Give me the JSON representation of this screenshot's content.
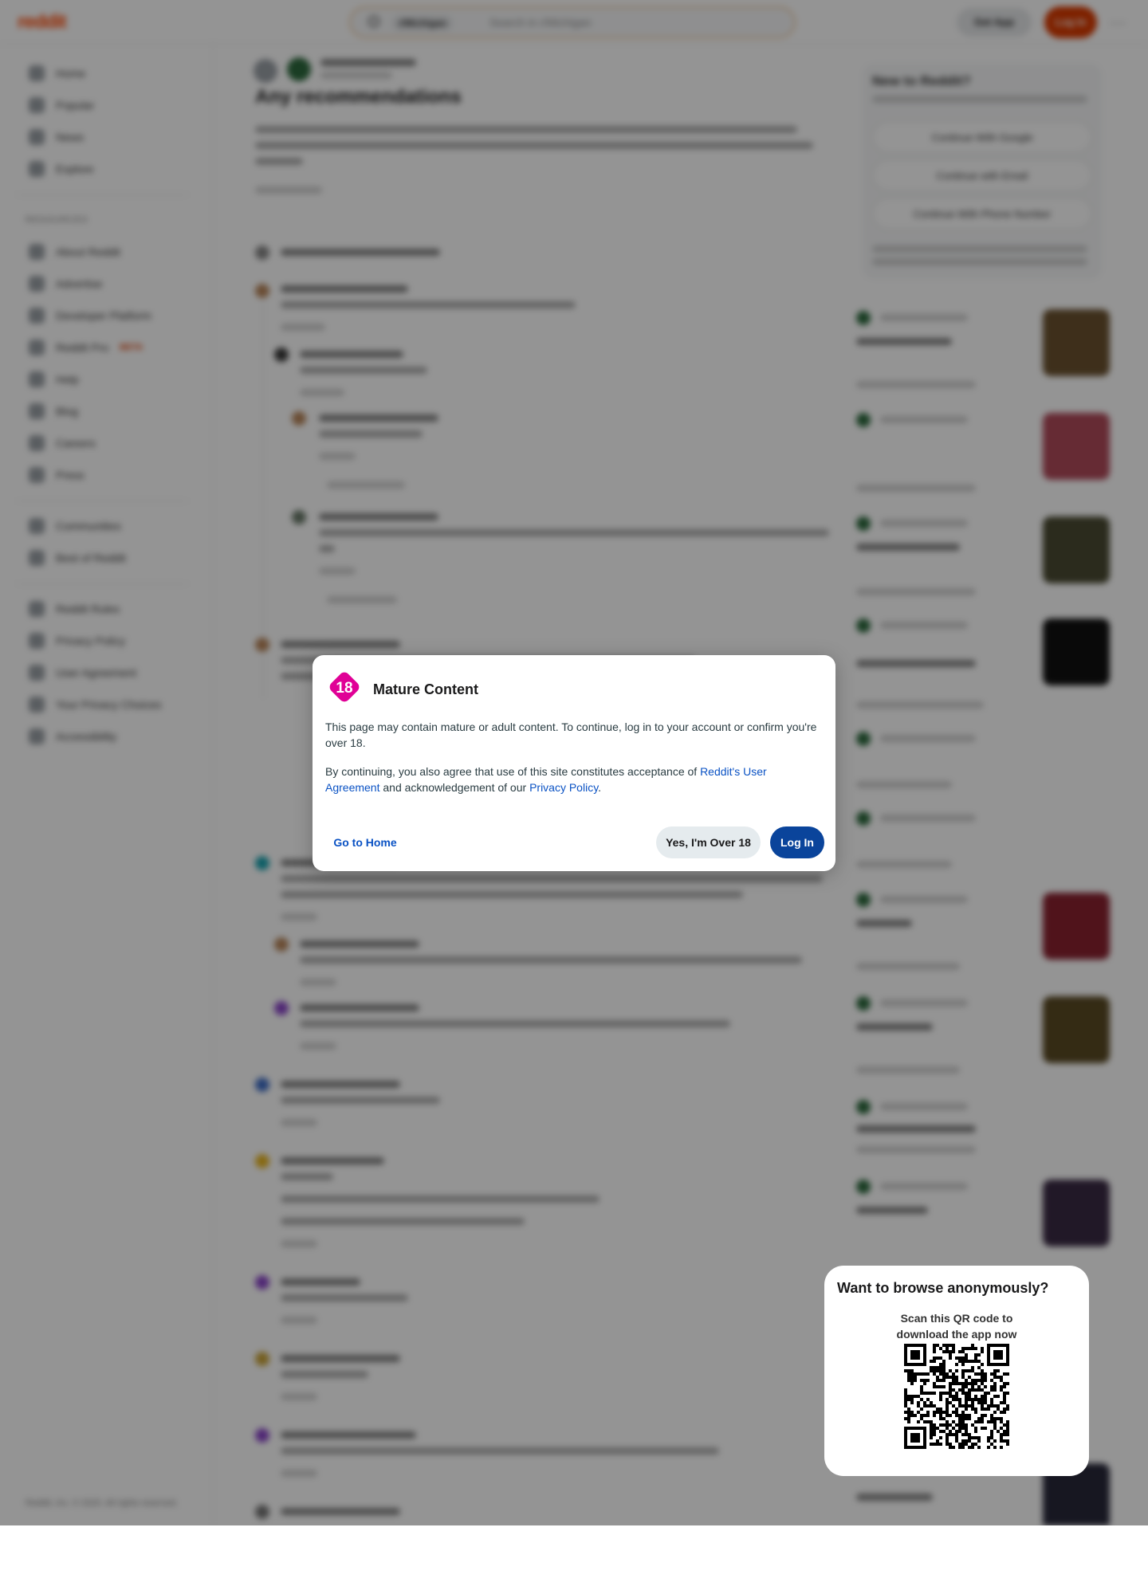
{
  "header": {
    "logo": "reddit",
    "search_chip": "r/Michigan",
    "search_placeholder": "Search in r/Michigan",
    "get_app": "Get App",
    "log_in": "Log In",
    "more": "···"
  },
  "sidebar": {
    "main_items": [
      "Home",
      "Popular",
      "News",
      "Explore"
    ],
    "resources_heading": "RESOURCES",
    "resource_items": [
      "About Reddit",
      "Advertise",
      "Developer Platform",
      "Reddit Pro",
      "Help",
      "Blog",
      "Careers",
      "Press"
    ],
    "beta_label": "BETA",
    "community_items": [
      "Communities",
      "Best of Reddit"
    ],
    "policy_items": [
      "Reddit Rules",
      "Privacy Policy",
      "User Agreement",
      "Your Privacy Choices",
      "Accessibility"
    ],
    "copyright": "Reddit, Inc. © 2025. All rights reserved."
  },
  "post": {
    "title": "Any recommendations"
  },
  "signup_card": {
    "title": "New to Reddit?",
    "buttons": [
      "Continue With Google",
      "Continue with Email",
      "Continue With Phone Number"
    ]
  },
  "modal": {
    "badge": "18",
    "title": "Mature Content",
    "body1": "This page may contain mature or adult content. To continue, log in to your account or confirm you're over 18.",
    "body2_prefix": "By continuing, you also agree that use of this site constitutes acceptance of ",
    "user_agreement_link": "Reddit's User Agreement",
    "body2_middle": " and acknowledgement of our ",
    "privacy_link": "Privacy Policy",
    "body2_suffix": ".",
    "go_home": "Go to Home",
    "over18": "Yes, I'm Over 18",
    "login": "Log In"
  },
  "qr_popup": {
    "title": "Want to browse anonymously?",
    "subtitle_line1": "Scan this QR code to",
    "subtitle_line2": "download the app now"
  },
  "colors": {
    "nsfw": "#e00096",
    "link": "#0a52c4",
    "primary_button": "#0a449b",
    "reddit_orange": "#d93a00"
  }
}
